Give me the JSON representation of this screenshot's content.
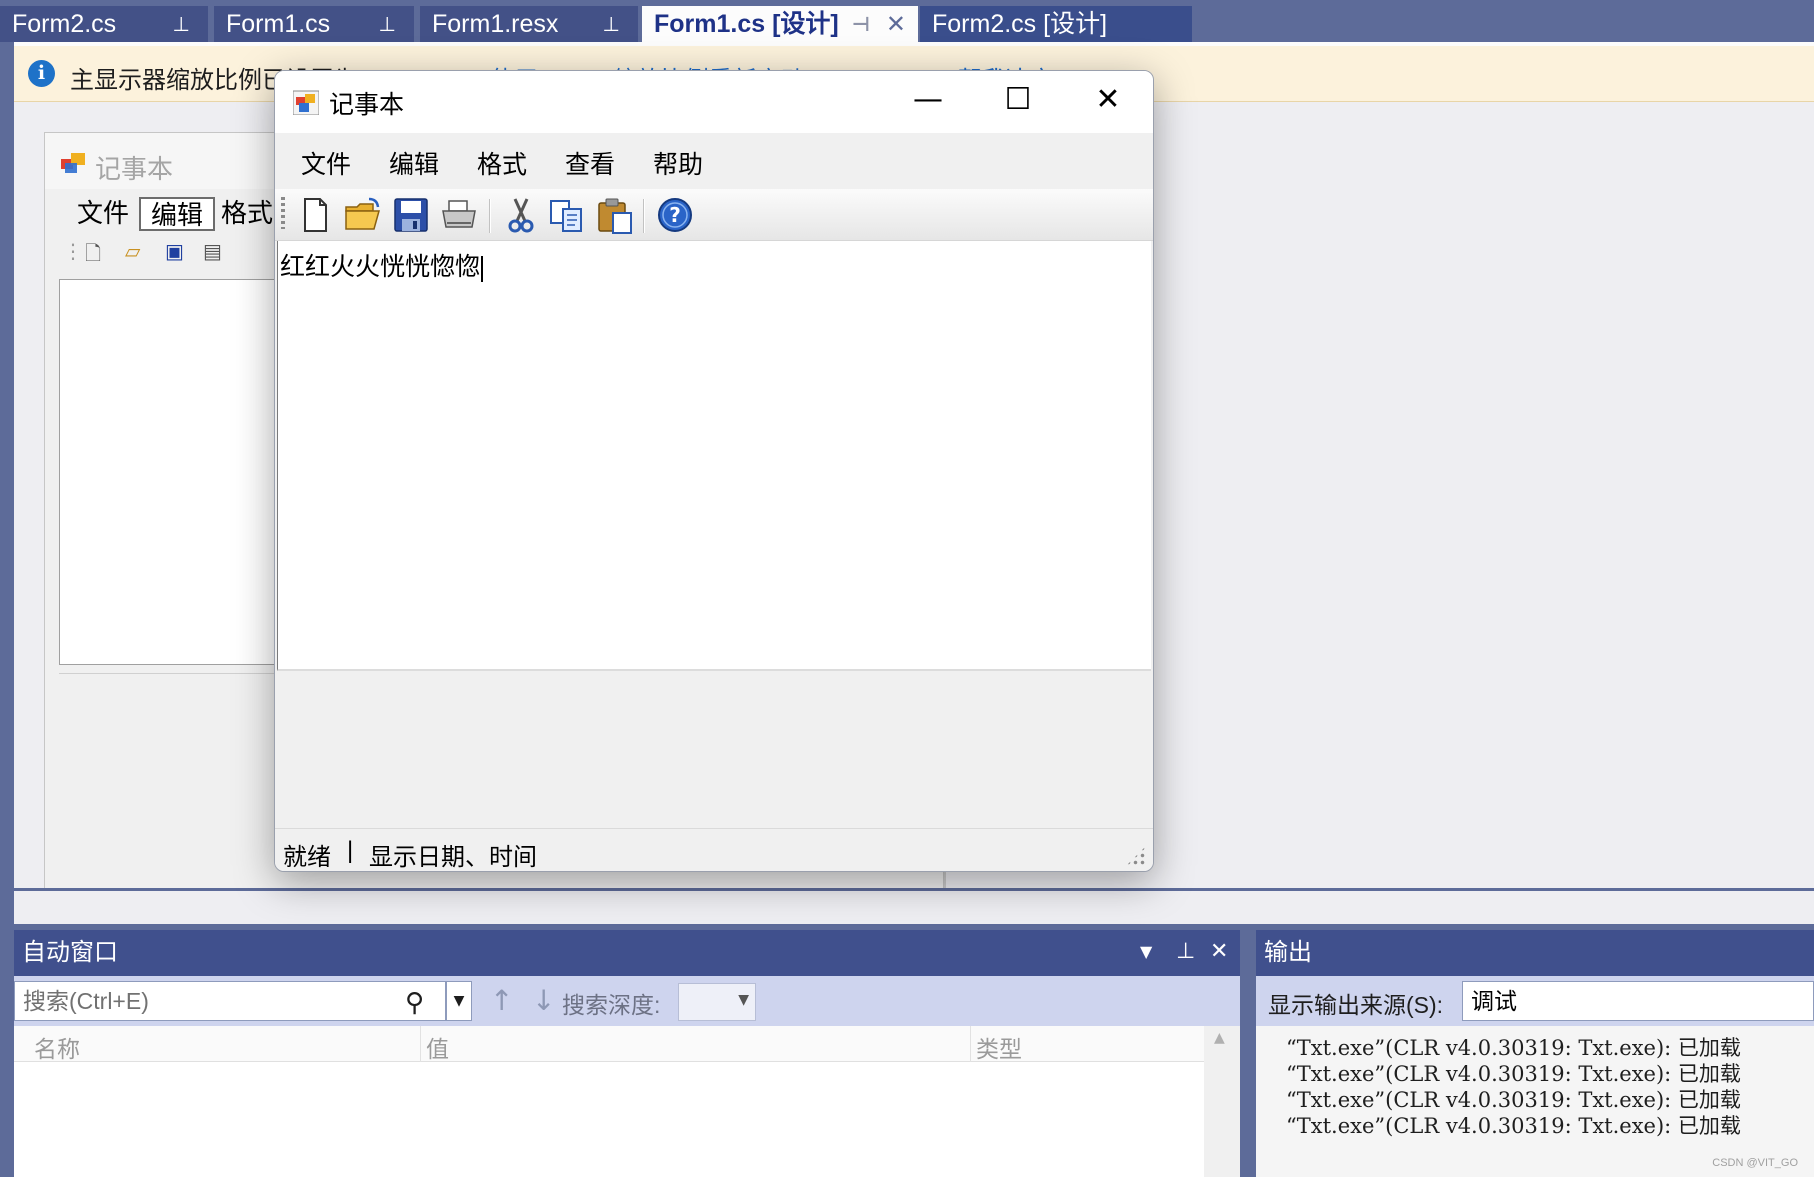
{
  "tabs": [
    {
      "label": "Form2.cs",
      "state": "inactive"
    },
    {
      "label": "Form1.cs",
      "state": "inactive"
    },
    {
      "label": "Form1.resx",
      "state": "inactive"
    },
    {
      "label": "Form1.cs [设计]",
      "state": "active"
    },
    {
      "label": "Form2.cs [设计]",
      "state": "preview"
    }
  ],
  "infobar": {
    "message": "主显示器缩放比例已设置为 200%",
    "link": "使用 100% 缩放比例重新启动 Visual Studio    帮我决定"
  },
  "design_form": {
    "title": "记事本",
    "menu": [
      "文件",
      "编辑",
      "格式"
    ],
    "selected_menu": "编辑"
  },
  "notepad": {
    "title": "记事本",
    "menu": [
      "文件",
      "编辑",
      "格式",
      "查看",
      "帮助"
    ],
    "toolbar_icons": [
      "new-file-icon",
      "open-folder-icon",
      "save-icon",
      "print-icon",
      "cut-icon",
      "copy-icon",
      "paste-icon",
      "help-icon"
    ],
    "editor_text": "红红火火恍恍惚惚",
    "status": {
      "left": "就绪",
      "separator": "|",
      "right": "显示日期、时间"
    },
    "window_buttons": {
      "minimize": "—",
      "maximize": "☐",
      "close": "✕"
    }
  },
  "autos_window": {
    "title": "自动窗口",
    "search_placeholder": "搜索(Ctrl+E)",
    "search_depth_label": "搜索深度:",
    "columns": [
      "名称",
      "值",
      "类型"
    ]
  },
  "output_window": {
    "title": "输出",
    "source_label": "显示输出来源(S):",
    "source_value": "调试",
    "lines": [
      "“Txt.exe”(CLR v4.0.30319: Txt.exe): 已加载",
      "“Txt.exe”(CLR v4.0.30319: Txt.exe): 已加载",
      "“Txt.exe”(CLR v4.0.30319: Txt.exe): 已加载",
      "“Txt.exe”(CLR v4.0.30319: Txt.exe): 已加载"
    ]
  },
  "watermark": "CSDN @VIT_GO",
  "colors": {
    "ide_chrome": "#5d6b99",
    "tool_header": "#40508d",
    "infobar_bg": "#fcf2dc",
    "active_tab_text": "#1e3287",
    "link": "#1e6ac8"
  }
}
